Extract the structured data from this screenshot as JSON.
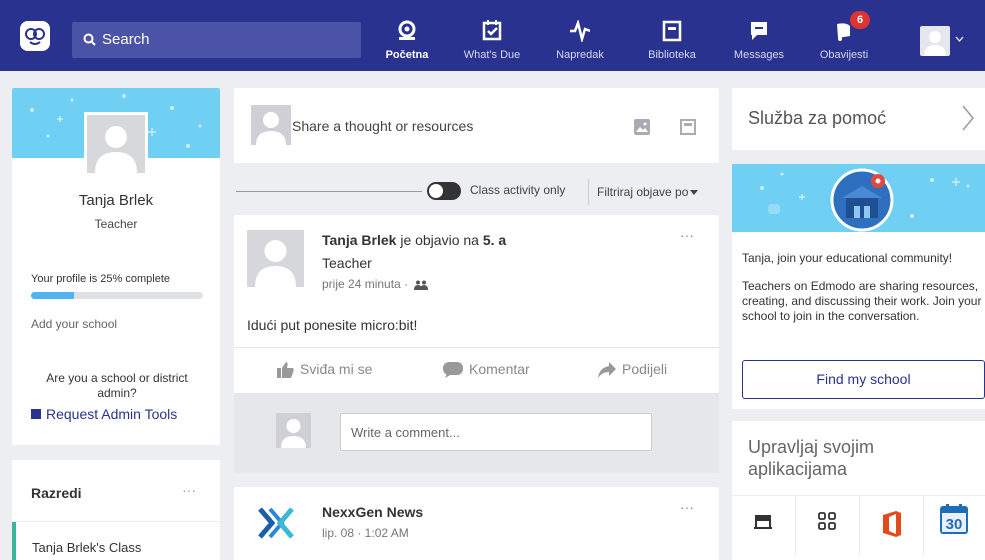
{
  "nav": {
    "search_placeholder": "Search",
    "items": [
      {
        "label": "Početna",
        "icon": "home-icon"
      },
      {
        "label": "What's Due",
        "icon": "calendar-check-icon"
      },
      {
        "label": "Napredak",
        "icon": "pulse-icon"
      },
      {
        "label": "Biblioteka",
        "icon": "library-icon"
      },
      {
        "label": "Messages",
        "icon": "message-icon"
      },
      {
        "label": "Obavijesti",
        "icon": "bell-icon"
      }
    ],
    "notification_count": "6",
    "colors": {
      "bar": "#2a3290",
      "search": "#4b53a6"
    }
  },
  "profile": {
    "name": "Tanja Brlek",
    "role": "Teacher",
    "completion_text": "Your profile is 25% complete",
    "completion_pct": 25,
    "add_school": "Add your school",
    "district_question": "Are you a school or district admin?",
    "request_admin": "Request Admin Tools"
  },
  "classes": {
    "title": "Razredi",
    "more": "···",
    "items": [
      "Tanja Brlek's Class"
    ]
  },
  "composer": {
    "placeholder": "Share a thought or resources"
  },
  "filter": {
    "toggle_label": "Class activity only",
    "dropdown_label": "Filtriraj objave po"
  },
  "post": {
    "author": "Tanja Brlek",
    "verb": " je objavio na ",
    "target": "5. a",
    "role": "Teacher",
    "time": "prije 24 minuta",
    "separator": "·",
    "body": "Idući put ponesite micro:bit!",
    "more": "···",
    "like_label": "Sviđa mi se",
    "comment_label": "Komentar",
    "share_label": "Podijeli",
    "comment_placeholder": "Write a comment..."
  },
  "news": {
    "title": "NexxGen News",
    "date": "lip. 08 · 1:02 AM",
    "more": "···"
  },
  "help": {
    "title": "Služba za pomoć"
  },
  "promo": {
    "headline": "Tanja, join your educational community!",
    "body": "Teachers on Edmodo are sharing resources, creating, and discussing their work. Join your school to join in the conversation.",
    "button": "Find my school"
  },
  "apps": {
    "title": "Upravljaj svojim aplikacijama",
    "icons": [
      "store-icon",
      "grid-icon",
      "office-icon",
      "calendar-30-icon"
    ],
    "calendar_day": "30"
  }
}
